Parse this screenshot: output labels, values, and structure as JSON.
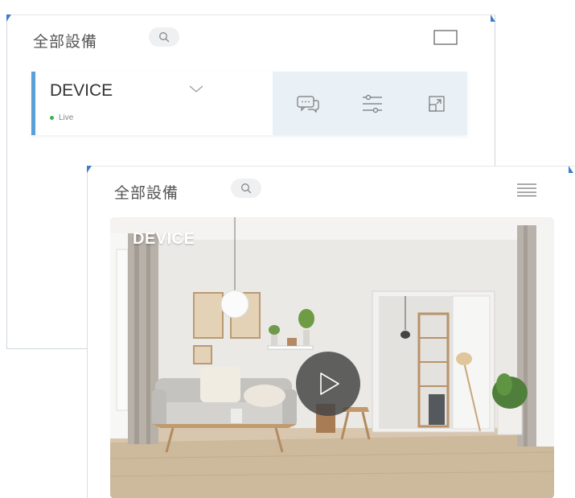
{
  "list_view": {
    "title": "全部設備",
    "device": {
      "name": "DEVICE",
      "status": "Live"
    },
    "icons": {
      "search": "search-icon",
      "view_toggle": "window-icon",
      "chevron": "chevron-down-icon",
      "chat": "chat-icon",
      "settings": "sliders-icon",
      "expand": "expand-icon"
    }
  },
  "grid_view": {
    "title": "全部設備",
    "device": {
      "name": "DEVICE"
    },
    "icons": {
      "search": "search-icon",
      "menu": "menu-icon",
      "play": "play-icon"
    }
  },
  "colors": {
    "accent": "#5a9fd8",
    "live": "#3bb34a",
    "action_bar": "#e9f1f7",
    "corner": "#3d7fc7"
  }
}
